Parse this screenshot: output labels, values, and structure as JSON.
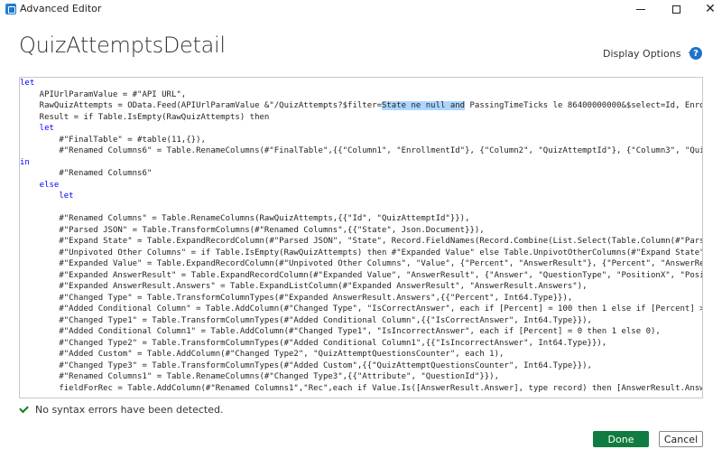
{
  "window": {
    "title": "Advanced Editor",
    "controls": {
      "minimize": "minimize",
      "maximize": "maximize",
      "close": "✕"
    }
  },
  "query_title": "QuizAttemptsDetail",
  "toolbar": {
    "display_options": "Display Options",
    "help": "?"
  },
  "code": {
    "lines": [
      {
        "pre": "let",
        "sel": "",
        "post": ""
      },
      {
        "pre": "    APIUrlParamValue = #\"API URL\",",
        "sel": "",
        "post": ""
      },
      {
        "pre": "    RawQuizAttempts = OData.Feed(APIUrlParamValue &\"/QuizAttempts?$filter=",
        "sel": "State ne null and",
        "post": " PassingTimeTicks le 86400000000&$select=Id, Enrol"
      },
      {
        "pre": "    Result = if Table.IsEmpty(RawQuizAttempts) then",
        "sel": "",
        "post": ""
      },
      {
        "pre": "    let",
        "sel": "",
        "post": ""
      },
      {
        "pre": "        #\"FinalTable\" = #table(11,{}),",
        "sel": "",
        "post": ""
      },
      {
        "pre": "        #\"Renamed Columns6\" = Table.RenameColumns(#\"FinalTable\",{{\"Column1\", \"EnrollmentId\"}, {\"Column2\", \"QuizAttemptId\"}, {\"Column3\", \"Quiz",
        "sel": "",
        "post": ""
      },
      {
        "pre": "in",
        "sel": "",
        "post": ""
      },
      {
        "pre": "        #\"Renamed Columns6\"",
        "sel": "",
        "post": ""
      },
      {
        "pre": "    else",
        "sel": "",
        "post": ""
      },
      {
        "pre": "        let",
        "sel": "",
        "post": ""
      },
      {
        "pre": "",
        "sel": "",
        "post": ""
      },
      {
        "pre": "        #\"Renamed Columns\" = Table.RenameColumns(RawQuizAttempts,{{\"Id\", \"QuizAttemptId\"}}),",
        "sel": "",
        "post": ""
      },
      {
        "pre": "        #\"Parsed JSON\" = Table.TransformColumns(#\"Renamed Columns\",{{\"State\", Json.Document}}),",
        "sel": "",
        "post": ""
      },
      {
        "pre": "        #\"Expand State\" = Table.ExpandRecordColumn(#\"Parsed JSON\", \"State\", Record.FieldNames(Record.Combine(List.Select(Table.Column(#\"Parse",
        "sel": "",
        "post": ""
      },
      {
        "pre": "        #\"Unpivoted Other Columns\" = if Table.IsEmpty(RawQuizAttempts) then #\"Expanded Value\" else Table.UnpivotOtherColumns(#\"Expand State\",",
        "sel": "",
        "post": ""
      },
      {
        "pre": "        #\"Expanded Value\" = Table.ExpandRecordColumn(#\"Unpivoted Other Columns\", \"Value\", {\"Percent\", \"AnswerResult\"}, {\"Percent\", \"AnswerRes",
        "sel": "",
        "post": ""
      },
      {
        "pre": "        #\"Expanded AnswerResult\" = Table.ExpandRecordColumn(#\"Expanded Value\", \"AnswerResult\", {\"Answer\", \"QuestionType\", \"PositionX\", \"Posit",
        "sel": "",
        "post": ""
      },
      {
        "pre": "        #\"Expanded AnswerResult.Answers\" = Table.ExpandListColumn(#\"Expanded AnswerResult\", \"AnswerResult.Answers\"),",
        "sel": "",
        "post": ""
      },
      {
        "pre": "        #\"Changed Type\" = Table.TransformColumnTypes(#\"Expanded AnswerResult.Answers\",{{\"Percent\", Int64.Type}}),",
        "sel": "",
        "post": ""
      },
      {
        "pre": "        #\"Added Conditional Column\" = Table.AddColumn(#\"Changed Type\", \"IsCorrectAnswer\", each if [Percent] = 100 then 1 else if [Percent] > 0",
        "sel": "",
        "post": ""
      },
      {
        "pre": "        #\"Changed Type1\" = Table.TransformColumnTypes(#\"Added Conditional Column\",{{\"IsCorrectAnswer\", Int64.Type}}),",
        "sel": "",
        "post": ""
      },
      {
        "pre": "        #\"Added Conditional Column1\" = Table.AddColumn(#\"Changed Type1\", \"IsIncorrectAnswer\", each if [Percent] = 0 then 1 else 0),",
        "sel": "",
        "post": ""
      },
      {
        "pre": "        #\"Changed Type2\" = Table.TransformColumnTypes(#\"Added Conditional Column1\",{{\"IsIncorrectAnswer\", Int64.Type}}),",
        "sel": "",
        "post": ""
      },
      {
        "pre": "        #\"Added Custom\" = Table.AddColumn(#\"Changed Type2\", \"QuizAttemptQuestionsCounter\", each 1),",
        "sel": "",
        "post": ""
      },
      {
        "pre": "        #\"Changed Type3\" = Table.TransformColumnTypes(#\"Added Custom\",{{\"QuizAttemptQuestionsCounter\", Int64.Type}}),",
        "sel": "",
        "post": ""
      },
      {
        "pre": "        #\"Renamed Columns1\" = Table.RenameColumns(#\"Changed Type3\",{{\"Attribute\", \"QuestionId\"}}),",
        "sel": "",
        "post": ""
      },
      {
        "pre": "        fieldForRec = Table.AddColumn(#\"Renamed Columns1\",\"Rec\",each if Value.Is([AnswerResult.Answer], type record) then [AnswerResult.Answe",
        "sel": "",
        "post": ""
      }
    ]
  },
  "status": {
    "text": "No syntax errors have been detected."
  },
  "buttons": {
    "done": "Done",
    "cancel": "Cancel"
  },
  "colors": {
    "accent": "#107c41",
    "help": "#1e73c9",
    "selection": "#add6ff",
    "status_ok": "#107c10"
  }
}
